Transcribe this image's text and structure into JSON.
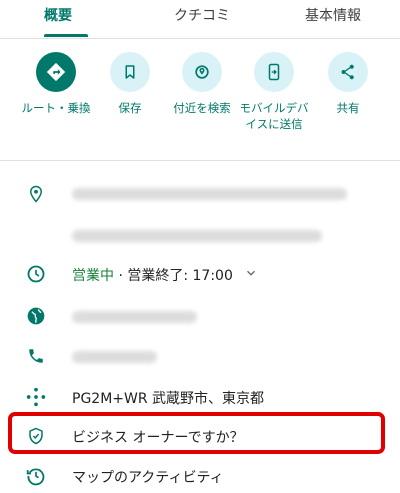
{
  "tabs": [
    {
      "label": "概要",
      "active": true
    },
    {
      "label": "クチコミ",
      "active": false
    },
    {
      "label": "基本情報",
      "active": false
    }
  ],
  "actions": [
    {
      "label": "ルート・乗換",
      "icon": "directions-icon"
    },
    {
      "label": "保存",
      "icon": "bookmark-icon"
    },
    {
      "label": "付近を検索",
      "icon": "nearby-icon"
    },
    {
      "label": "モバイルデバイスに送信",
      "icon": "send-to-phone-icon"
    },
    {
      "label": "共有",
      "icon": "share-icon"
    }
  ],
  "info": {
    "hours_status": "営業中",
    "hours_separator": "·",
    "hours_detail": "営業終了: 17:00",
    "plus_code": "PG2M+WR 武蔵野市、東京都",
    "claim_business": "ビジネス オーナーですか？",
    "activity": "マップのアクティビティ"
  },
  "colors": {
    "accent": "#00796b",
    "open_green": "#188038",
    "highlight_red": "#e00000"
  }
}
